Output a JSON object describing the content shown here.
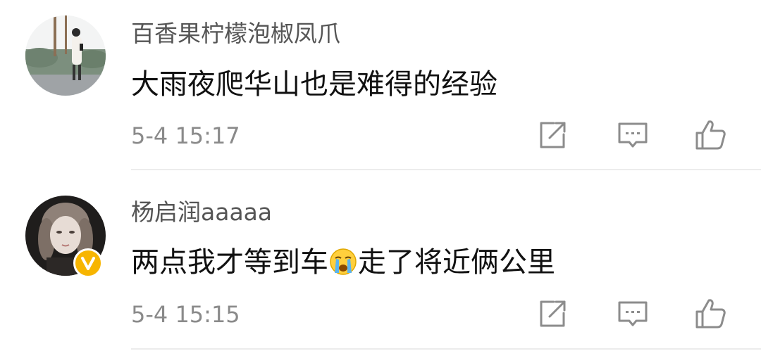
{
  "comments": [
    {
      "username": "百香果柠檬泡椒凤爪",
      "content": "大雨夜爬华山也是难得的经验",
      "timestamp": "5-4 15:17",
      "verified": false
    },
    {
      "username": "杨启润aaaaa",
      "content_before_emoji": "两点我才等到车",
      "emoji": "crying-face-icon",
      "content_after_emoji": "走了将近俩公里",
      "timestamp": "5-4 15:15",
      "verified": true
    }
  ],
  "actions": [
    "share-icon",
    "reply-icon",
    "like-icon"
  ],
  "colors": {
    "username": "#555555",
    "content": "#111111",
    "timestamp": "#8a8a8a",
    "icon": "#8c8c8c",
    "verified_badge": "#f7b500",
    "divider": "#ececec"
  }
}
